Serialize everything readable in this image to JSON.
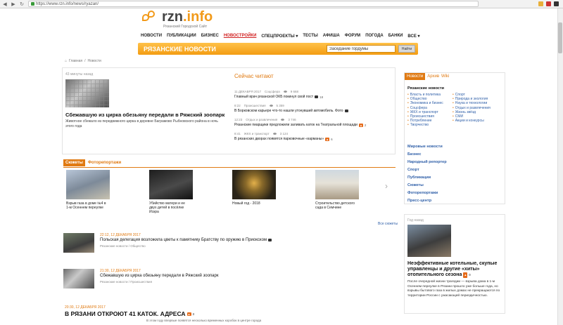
{
  "browser": {
    "url": "https://www.rzn.info/news/ryazan/"
  },
  "logo": {
    "name_main": "rzn",
    "name_tld": ".info",
    "subtitle": "Рязанский Городской Сайт"
  },
  "menu": [
    "НОВОСТИ",
    "ПУБЛИКАЦИИ",
    "БИЗНЕС",
    "НОВОСТРОЙКИ",
    "СПЕЦПРОЕКТЫ ▾",
    "ТЕСТЫ",
    "АФИША",
    "ФОРУМ",
    "ПОГОДА",
    "БАНКИ",
    "ВСЕ ▾"
  ],
  "section_title": "РЯЗАНСКИЕ НОВОСТИ",
  "search": {
    "value": "Заседание гордумы",
    "button": "Найти"
  },
  "breadcrumb": {
    "home": "Главная",
    "sep": "/",
    "current": "Новости"
  },
  "featured": {
    "time_ago": "43 минуты назад",
    "title": "Сбежавшую из цирка обезьяну передали в Ряжский зоопарк",
    "desc": "Животное сбежало из передвижного цирка в деревне Баграмово Рыбновского района в ночь этого года"
  },
  "reading_now": {
    "title": "Сейчас читают",
    "items": [
      {
        "meta": "11 ДЕКАБРЯ 2017",
        "cat": "Соцсфера",
        "views": "9 668",
        "text": "Главный врач рязанской ОКБ покинул свой пост",
        "count": "18"
      },
      {
        "meta": "8:22",
        "cat": "Происшествия",
        "views": "5 359",
        "text": "В Борковском карьере что-то нашли утонувший автомобиль. Фото",
        "count": ""
      },
      {
        "meta": "12:23",
        "cat": "Отдых и развлечения",
        "views": "3 746",
        "text": "Рязанские пиарщики предложили заливать каток на Театральной площади",
        "count": "2"
      },
      {
        "meta": "8:41",
        "cat": "ЖКХ и транспорт",
        "views": "3 124",
        "text": "В рязанских дворах появятся парковочные «карманы»",
        "count": "6"
      }
    ]
  },
  "stories": {
    "tabs": [
      "Сюжеты",
      "Фоторепортажи"
    ],
    "items": [
      {
        "caption": "Взрыв газа в доме №4 в 1-м Осеннем переулке"
      },
      {
        "caption": "Убийство матери и ее двух детей в посёлке Искра"
      },
      {
        "caption": "Новый год - 2018"
      },
      {
        "caption": "Строительство детского сада в Семчине"
      }
    ],
    "all_link": "Все сюжеты"
  },
  "news": [
    {
      "date": "22:12, 12 ДЕКАБРЯ 2017",
      "title": "Польская делегация возложила цветы к памятнику Братству по оружию в Приокском",
      "cat": "Рязанские новости  /  Общество"
    },
    {
      "date": "21:30, 12 ДЕКАБРЯ 2017",
      "title": "Сбежавшую из цирка обезьяну передали в Ряжский зоопарк",
      "cat": "Рязанские новости  /  Происшествия"
    }
  ],
  "bottom_news": {
    "date": "20:30, 12 ДЕКАБРЯ 2017",
    "title": "В РЯЗАНИ ОТКРОЮТ 41 КАТОК. АДРЕСА",
    "count": "3",
    "text": "В этом году впервые появятся несколько временных коробок в центре города"
  },
  "sidebar": {
    "tabs": [
      "Новости",
      "Архив",
      "Wiki"
    ],
    "heading": "Рязанские новости",
    "col1": [
      "Власть и политика",
      "Общество",
      "Экономика и бизнес",
      "Соцсфера",
      "ЖКХ и транспорт",
      "Происшествия",
      "Потребление",
      "Творчество"
    ],
    "col2": [
      "Спорт",
      "Природа и экология",
      "Наука и технологии",
      "Отдых и развлечения",
      "Жизнь звёзд",
      "СМИ",
      "Акции и конкурсы"
    ],
    "links": [
      "Мировые новости",
      "Бизнес",
      "Народный репортер",
      "Спорт",
      "Публикации",
      "Сюжеты",
      "Фоторепортажи",
      "Пресс-центр"
    ]
  },
  "sidebar2": {
    "ago": "Год назад",
    "title": "Неэффективные котельные, скупые управленцы и другие «хиты» отопительного сезона",
    "count": "0",
    "text": "После очередной жизни трагедии — взрыва дома в 1-м Осеннем переулке в Рязани прошло уже больше года, но взрывы бытового газа в жилых домах не прекращаются по территории России с ужасающей периодичностью."
  }
}
